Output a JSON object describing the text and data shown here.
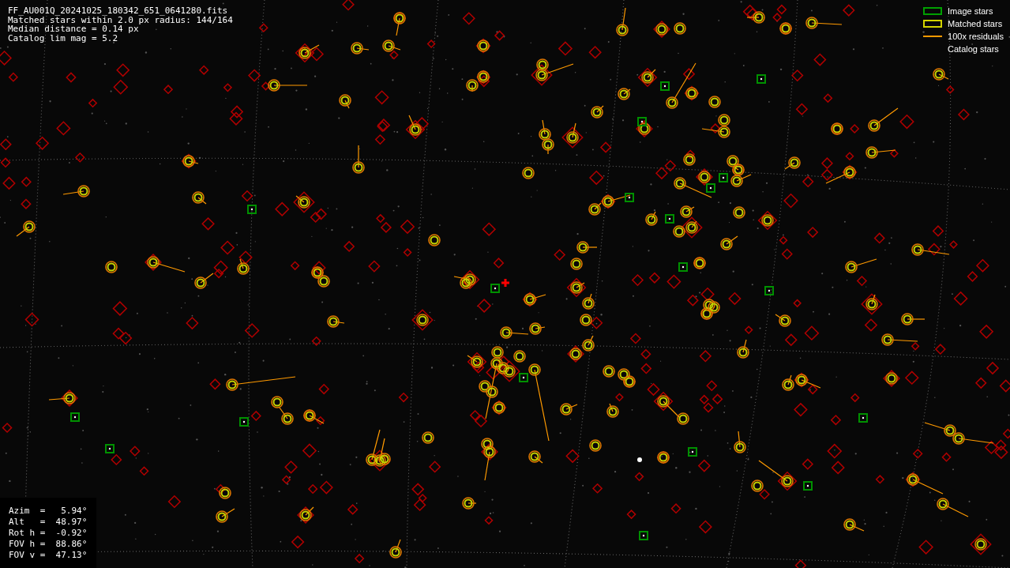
{
  "info": {
    "lines": [
      "FF_AU001Q_20241025_180342_651_0641280.fits",
      "Matched stars within 2.0 px radius: 144/164",
      "Median distance = 0.14 px",
      "Catalog lim mag = 5.2"
    ]
  },
  "legend": [
    {
      "kind": "image",
      "label": "Image stars"
    },
    {
      "kind": "matched",
      "label": "Matched stars"
    },
    {
      "kind": "residual",
      "label": "100x residuals"
    },
    {
      "kind": "catalog",
      "label": "Catalog stars"
    }
  ],
  "pointing": {
    "lines": [
      "Azim  =   5.94°",
      "Alt   =  48.97°",
      "Rot h =  -0.92°",
      "FOV h =  88.86°",
      "FOV v =  47.13°"
    ]
  }
}
